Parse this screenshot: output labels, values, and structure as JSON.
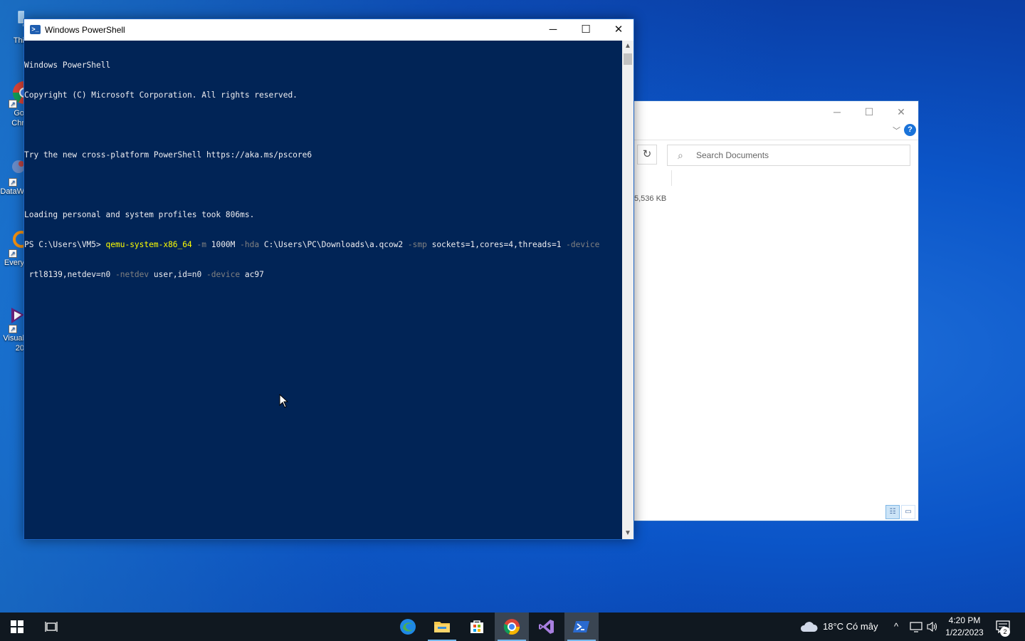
{
  "desktop": {
    "icons": [
      {
        "name": "this-pc",
        "label": "Thi"
      },
      {
        "name": "google-chrome",
        "label": "Go\nChr"
      },
      {
        "name": "datawarrior",
        "label": "DataW"
      },
      {
        "name": "everything",
        "label": "Every"
      },
      {
        "name": "visual-studio",
        "label": "Visual\n20"
      }
    ]
  },
  "powershell": {
    "title": "Windows PowerShell",
    "controls": {
      "minimize": "─",
      "maximize": "☐",
      "close": "✕"
    },
    "console": {
      "line1": "Windows PowerShell",
      "line2": "Copyright (C) Microsoft Corporation. All rights reserved.",
      "line3": "",
      "line4": "Try the new cross-platform PowerShell https://aka.ms/pscore6",
      "line5": "",
      "line6": "Loading personal and system profiles took 806ms.",
      "prompt": "PS C:\\Users\\VM5> ",
      "cmd": "qemu-system-x86_64",
      "p_m": " -m ",
      "a_m": "1000M",
      "p_hda": " -hda ",
      "a_hda": "C:\\Users\\PC\\Downloads\\a.qcow2",
      "p_smp": " -smp ",
      "a_smp": "sockets=1,cores=4,threads=1",
      "p_device1": " -device",
      "a_device1": " rtl8139,netdev=n0",
      "p_netdev": " -netdev ",
      "a_netdev": "user,id=n0",
      "p_device2": " -device ",
      "a_device2": "ac97"
    }
  },
  "explorer": {
    "controls": {
      "minimize": "─",
      "maximize": "☐",
      "close": "✕"
    },
    "help": "?",
    "search_placeholder": "Search Documents",
    "size_text": "5,536 KB"
  },
  "taskbar": {
    "weather": "18°C  Có mây",
    "time": "4:20 PM",
    "date": "1/22/2023",
    "notifications": "2"
  }
}
